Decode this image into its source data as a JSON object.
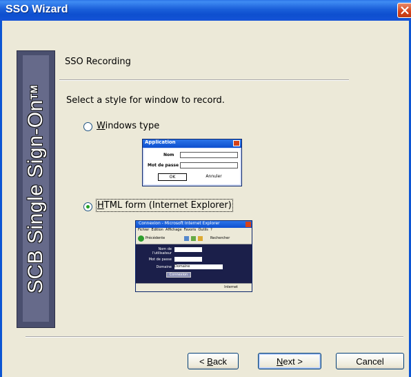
{
  "window": {
    "title": "SSO Wizard"
  },
  "banner": {
    "text": "SCB Single Sign-On",
    "trademark": "TM"
  },
  "step": {
    "title": "SSO Recording"
  },
  "prompt": "Select a style for window to record.",
  "options": [
    {
      "label_mnemonic": "W",
      "label_rest": "indows type",
      "selected": false
    },
    {
      "label_mnemonic": "H",
      "label_rest": "TML form (Internet Explorer)",
      "selected": true
    }
  ],
  "preview_windows": {
    "title": "Application",
    "field1_label": "Nom",
    "field2_label": "Mot de passe",
    "ok_label": "OK",
    "cancel_label": "Annuler"
  },
  "preview_html": {
    "title": "Connexion - Microsoft Internet Explorer",
    "menu": [
      "Fichier",
      "Edition",
      "Affichage",
      "Favoris",
      "Outils",
      "?"
    ],
    "back_label": "Précédente",
    "search_label": "Rechercher",
    "field_labels": [
      "Nom de l'utilisateur",
      "Mot de passe",
      "Domaine"
    ],
    "domain_value": "Domaine",
    "submit_label": "Connexion",
    "status_zone": "Internet"
  },
  "buttons": {
    "back_prefix": "< ",
    "back_mnemonic": "B",
    "back_rest": "ack",
    "next_mnemonic": "N",
    "next_rest": "ext >",
    "cancel": "Cancel"
  },
  "colors": {
    "title_bar": "#0d4fcf",
    "banner": "#4a4f6e",
    "radio_dot": "#21a121",
    "dialog_bg": "#ece9d8"
  }
}
